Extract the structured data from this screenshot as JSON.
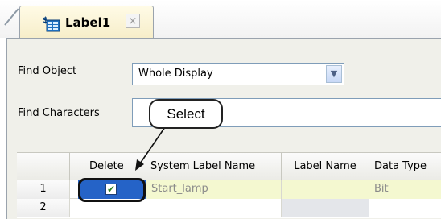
{
  "tab": {
    "label": "Label1",
    "close_glyph": "×",
    "icon": "label-sheet-icon"
  },
  "find_object": {
    "label": "Find Object",
    "value": "Whole Display"
  },
  "find_characters": {
    "label": "Find Characters",
    "value": ""
  },
  "grid": {
    "columns": [
      "Delete",
      "System Label Name",
      "Label Name",
      "Data Type"
    ],
    "rows": [
      {
        "num": "1",
        "checked": true,
        "system_label": "Start_lamp",
        "label_name": "",
        "data_type": "Bit"
      },
      {
        "num": "2",
        "checked": false,
        "system_label": "",
        "label_name": "",
        "data_type": ""
      }
    ]
  },
  "callout": {
    "text": "Select"
  },
  "colors": {
    "selection": "#2563c7",
    "highlight_row": "#f4f8d0",
    "panel": "#f0f0ea"
  }
}
